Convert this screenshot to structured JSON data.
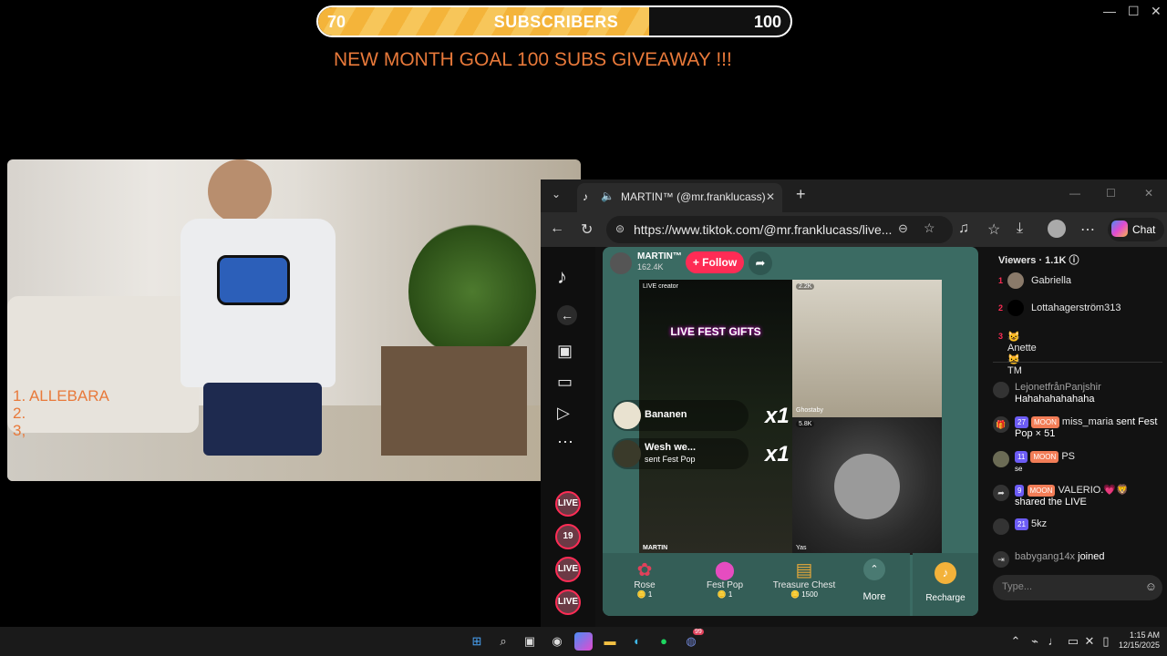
{
  "goal": {
    "current": "70",
    "label": "SUBSCRIBERS",
    "target": "100",
    "progress": 0.7
  },
  "goal_text": "NEW MONTH GOAL 100 SUBS GIVEAWAY !!!",
  "camera_overlay": {
    "list_1": "1. ALLEBARA",
    "list_2": "2.",
    "list_3": "3,"
  },
  "browser": {
    "tab_title": "MARTIN™ (@mr.franklucass)",
    "url": "https://www.tiktok.com/@mr.franklucass/live...",
    "chat_label": "Chat"
  },
  "stream": {
    "streamer_name": "MARTIN™",
    "streamer_likes": "162.4K",
    "follow_label": "+ Follow",
    "live_fest_title": "LIVE FEST GIFTS",
    "cam_badge_1": "2.2K",
    "cam_badge_2": "5.8K",
    "cam_label_left": "LIVE creator",
    "cam_name_left": "MARTIN",
    "cam_name_right1": "Ghostaby",
    "cam_name_right2": "Yas",
    "gift_events": [
      {
        "name": "Bananen",
        "sub": "",
        "combo": "x1"
      },
      {
        "name": "Wesh we...",
        "sub": "sent Fest Pop",
        "combo": "x1"
      }
    ],
    "gifts": [
      {
        "name": "Rose",
        "price": "1",
        "icon": "rose-icon"
      },
      {
        "name": "Fest Pop",
        "price": "1",
        "icon": "fest-pop-icon"
      },
      {
        "name": "Treasure Chest",
        "price": "1500",
        "icon": "treasure-chest-icon"
      }
    ],
    "more_label": "More",
    "recharge_label": "Recharge"
  },
  "side_live_badges": [
    "LIVE",
    "LIVE",
    "LIVE",
    "LIVE"
  ],
  "side_live_number": "19",
  "chat": {
    "viewers_label": "Viewers",
    "viewers_count": "1.1K",
    "top_viewers": [
      {
        "rank": "1",
        "name": "Gabriella"
      },
      {
        "rank": "2",
        "name": "Lottahagerström313"
      },
      {
        "rank": "3",
        "name": "😺Anette😺 TM"
      }
    ],
    "messages": [
      {
        "user": "LejonetfrånPanjshir",
        "text": "Hahahahahahaha",
        "level": "",
        "moon": ""
      },
      {
        "user": "miss_maria",
        "text": "sent Fest Pop × 51",
        "level": "27",
        "moon": "MOON"
      },
      {
        "user": "PS",
        "text": "se",
        "level": "11",
        "moon": "MOON"
      },
      {
        "user": "VALERIO.💗🦁",
        "text": "shared the LIVE",
        "level": "9",
        "moon": "MOON"
      },
      {
        "user": "5kz",
        "text": "",
        "level": "21",
        "moon": ""
      },
      {
        "user": "babygang14x",
        "text": "joined",
        "level": "",
        "moon": ""
      }
    ],
    "input_placeholder": "Type..."
  },
  "taskbar": {
    "time": "1:15 AM",
    "date": "12/15/2025",
    "notification_count": "99"
  },
  "colors": {
    "accent": "#fe2c55",
    "goal_text": "#e8793a",
    "goal_fill": "#f4b43a",
    "stream_bg": "#3b6b63"
  }
}
